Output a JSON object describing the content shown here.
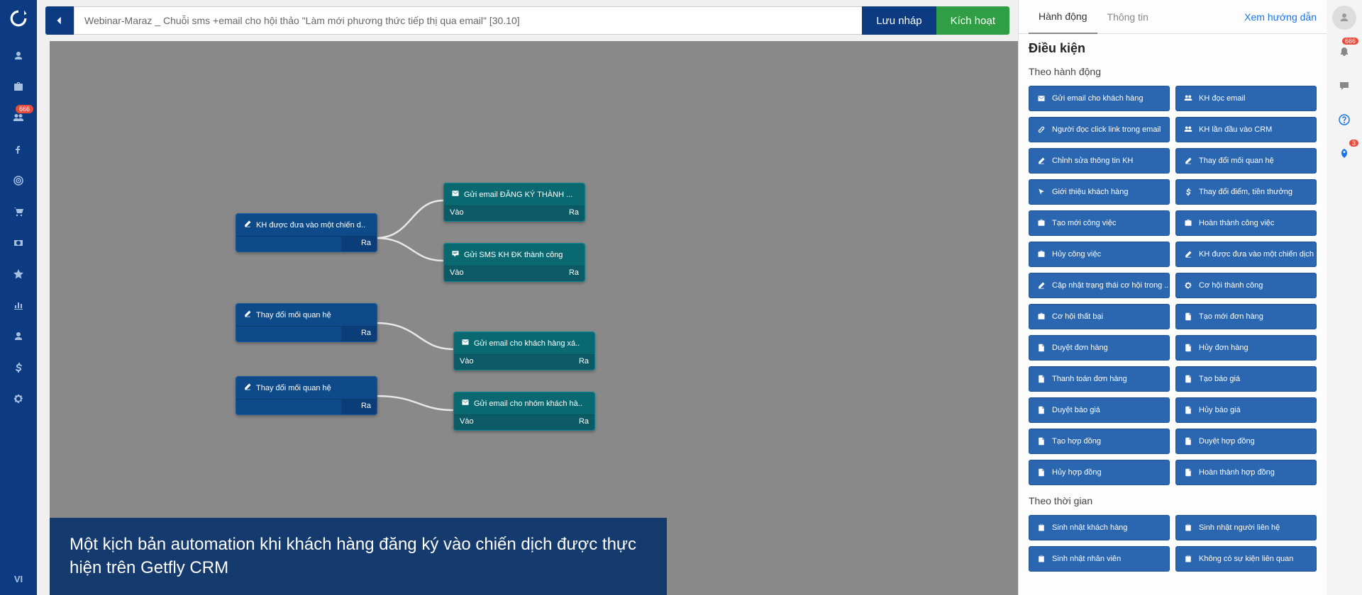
{
  "leftNav": {
    "badge1": "666",
    "lang": "VI"
  },
  "header": {
    "title": "Webinar-Maraz _ Chuỗi sms +email cho hội thảo \"Làm mới phương thức tiếp thị qua email\" [30.10]",
    "saveDraft": "Lưu nháp",
    "activate": "Kích hoạt"
  },
  "canvas": {
    "nodes": {
      "n1": "KH được đưa vào một chiến d..",
      "n2": "Gửi email ĐĂNG KÝ THÀNH ...",
      "n3": "Gửi SMS KH ĐK thành công",
      "n4": "Thay đổi mối quan hệ",
      "n5": "Gửi email cho khách hàng xá..",
      "n6": "Thay đổi mối quan hệ",
      "n7": "Gửi email cho nhóm khách hà..",
      "portIn": "Vào",
      "portOut": "Ra"
    }
  },
  "caption": "Một kịch bản automation khi khách hàng đăng ký vào chiến dịch được thực hiện trên Getfly CRM",
  "rightPanel": {
    "tab1": "Hành động",
    "tab2": "Thông tin",
    "help": "Xem hướng dẫn",
    "title": "Điều kiện",
    "section1": "Theo hành động",
    "actions": [
      "Gửi email cho khách hàng",
      "KH đọc email",
      "Người đọc click link trong email",
      "KH lần đầu vào CRM",
      "Chỉnh sửa thông tin KH",
      "Thay đổi mối quan hệ",
      "Giới thiệu khách hàng",
      "Thay đổi điểm, tiền thưởng",
      "Tạo mới công việc",
      "Hoàn thành công việc",
      "Hủy công việc",
      "KH được đưa vào một chiến dịch",
      "Cập nhật trạng thái cơ hội trong ...",
      "Cơ hội thành công",
      "Cơ hội thất bại",
      "Tạo mới đơn hàng",
      "Duyệt đơn hàng",
      "Hủy đơn hàng",
      "Thanh toán đơn hàng",
      "Tạo báo giá",
      "Duyệt báo giá",
      "Hủy báo giá",
      "Tạo hợp đồng",
      "Duyệt hợp đồng",
      "Hủy hợp đồng",
      "Hoàn thành hợp đồng"
    ],
    "icons": [
      "mail",
      "users",
      "link",
      "users",
      "edit",
      "edit",
      "pointer",
      "dollar",
      "briefcase",
      "briefcase",
      "briefcase",
      "edit",
      "edit",
      "gear",
      "briefcase",
      "file",
      "file",
      "file",
      "file",
      "file",
      "file",
      "file",
      "file",
      "file",
      "file",
      "file"
    ],
    "section2": "Theo thời gian",
    "timeActions": [
      "Sinh nhật khách hàng",
      "Sinh nhật người liên hệ",
      "Sinh nhật nhân viên",
      "Không có sự kiện liên quan"
    ]
  },
  "farRight": {
    "badge1": "666",
    "badge2": "3"
  }
}
